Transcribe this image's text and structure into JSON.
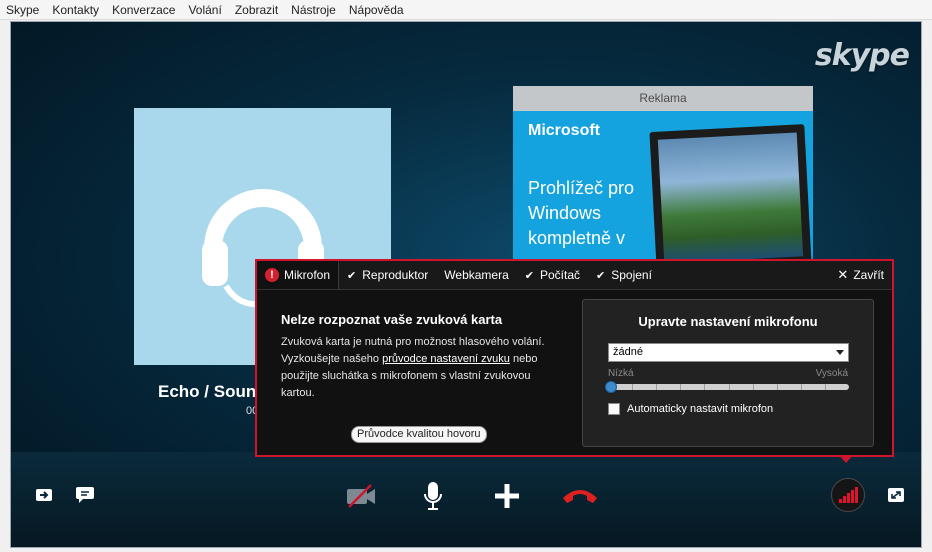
{
  "menubar": {
    "items": [
      "Skype",
      "Kontakty",
      "Konverzace",
      "Volání",
      "Zobrazit",
      "Nástroje",
      "Nápověda"
    ]
  },
  "logo": "skype",
  "contact": {
    "name": "Echo / Soun",
    "status": "00"
  },
  "ad": {
    "label": "Reklama",
    "brand": "Microsoft",
    "text": "Prohlížeč pro Windows kompletně v"
  },
  "popup": {
    "tabs": [
      {
        "label": "Mikrofon",
        "state": "error"
      },
      {
        "label": "Reproduktor",
        "state": "ok"
      },
      {
        "label": "Webkamera",
        "state": "none"
      },
      {
        "label": "Počítač",
        "state": "ok"
      },
      {
        "label": "Spojení",
        "state": "ok"
      }
    ],
    "close_label": "Zavřít",
    "error_title": "Nelze rozpoznat vaše zvuková karta",
    "error_text_1": "Zvuková karta je nutná pro možnost hlasového volání. Vyzkoušejte našeho ",
    "error_link": "průvodce nastavení zvuku",
    "error_text_2": " nebo použijte sluchátka s mikrofonem s vlastní zvukovou kartou.",
    "quality_button": "Průvodce kvalitou hovoru",
    "mic_panel": {
      "title": "Upravte nastavení mikrofonu",
      "selected_device": "žádné",
      "low_label": "Nízká",
      "high_label": "Vysoká",
      "level": 0,
      "auto_label": "Automaticky nastavit mikrofon",
      "auto_checked": false
    }
  },
  "colors": {
    "accent_red": "#d0142c",
    "avatar_bg": "#a9d8ec",
    "ad_blue": "#15a3df",
    "hangup": "#e02020"
  },
  "icons": [
    "share-screen-icon",
    "chat-icon",
    "video-off-icon",
    "microphone-icon",
    "add-icon",
    "hang-up-icon",
    "call-quality-icon",
    "fullscreen-icon",
    "headset-icon",
    "error-icon",
    "check-icon",
    "close-icon",
    "dropdown-arrow-icon"
  ]
}
